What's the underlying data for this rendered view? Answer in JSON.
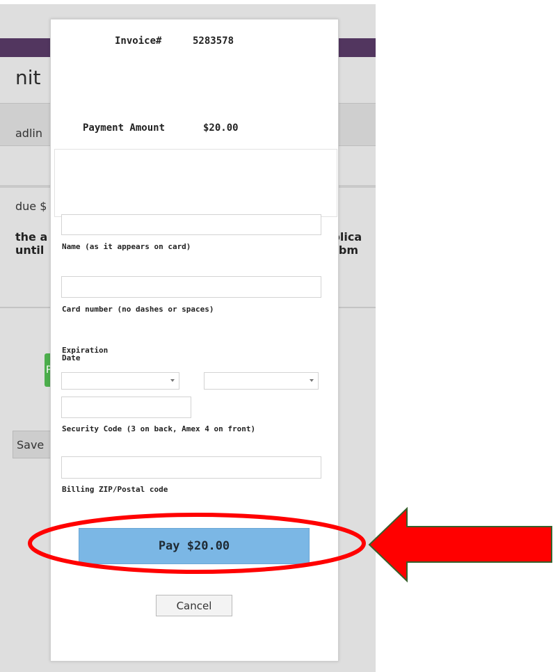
{
  "background": {
    "heading": "nit",
    "deadline_text": "adlin",
    "due_text": "due $",
    "bold_left_1": "the a",
    "bold_left_2": "until",
    "bold_right_1": "pplica",
    "bold_right_2": "subm",
    "green_button_text": "P",
    "save_button": "Save"
  },
  "modal": {
    "invoice_label": "Invoice#",
    "invoice_number": "5283578",
    "payment_amount_label": "Payment Amount",
    "payment_amount_value": "$20.00",
    "fields": {
      "name_label": "Name (as it appears on card)",
      "card_label": "Card number (no dashes or spaces)",
      "expiration_label_line1": "Expiration",
      "expiration_label_line2": "Date",
      "security_label": "Security Code (3 on back, Amex 4 on front)",
      "zip_label": "Billing ZIP/Postal code"
    },
    "pay_button": "Pay $20.00",
    "cancel_button": "Cancel"
  },
  "colors": {
    "annotation_red": "#ff0000",
    "pay_button_blue": "#7bb7e5",
    "header_purple": "#52365f"
  }
}
